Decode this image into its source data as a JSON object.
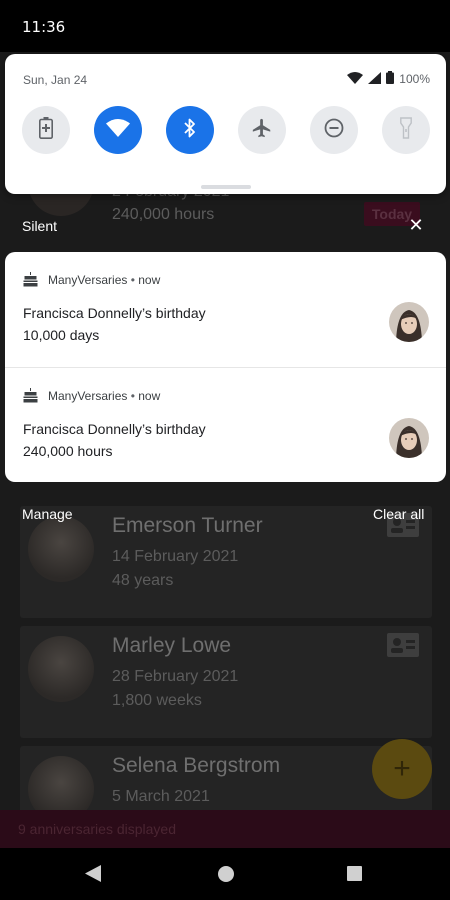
{
  "status_bar": {
    "time": "11:36"
  },
  "quick_settings": {
    "date": "Sun, Jan 24",
    "battery": "100%",
    "tiles": [
      {
        "name": "battery-saver",
        "state": "off"
      },
      {
        "name": "wifi",
        "state": "on"
      },
      {
        "name": "bluetooth",
        "state": "on"
      },
      {
        "name": "airplane-mode",
        "state": "off"
      },
      {
        "name": "do-not-disturb",
        "state": "off"
      },
      {
        "name": "flashlight",
        "state": "disabled"
      }
    ]
  },
  "notifications": {
    "section_label": "Silent",
    "items": [
      {
        "app": "ManyVersaries",
        "time": "now",
        "title": "Francisca Donnelly’s birthday",
        "text": "10,000 days"
      },
      {
        "app": "ManyVersaries",
        "time": "now",
        "title": "Francisca Donnelly’s birthday",
        "text": "240,000 hours"
      }
    ],
    "manage_label": "Manage",
    "clear_all_label": "Clear all"
  },
  "background_app": {
    "top_card": {
      "date": "2 February 2021",
      "amount": "240,000 hours",
      "badge": "Today"
    },
    "cards": [
      {
        "name": "Emerson Turner",
        "date": "14 February 2021",
        "amount": "48 years"
      },
      {
        "name": "Marley Lowe",
        "date": "28 February 2021",
        "amount": "1,800 weeks"
      },
      {
        "name": "Selena Bergstrom",
        "date": "5 March 2021",
        "amount": ""
      }
    ],
    "footer_text": "9 anniversaries displayed",
    "fab_label": "+"
  },
  "colors": {
    "accent_blue": "#1a73e8",
    "app_primary": "#b0004a",
    "fab_yellow": "#f5c518"
  }
}
